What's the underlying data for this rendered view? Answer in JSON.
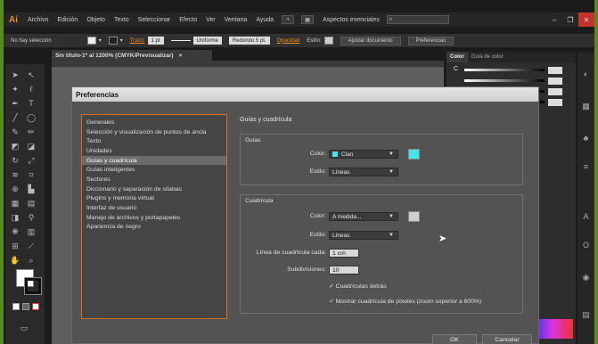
{
  "menubar": {
    "app_logo": "Ai",
    "items": [
      "Archivo",
      "Edición",
      "Objeto",
      "Texto",
      "Seleccionar",
      "Efecto",
      "Ver",
      "Ventana",
      "Ayuda"
    ],
    "workspace": "Aspectos esenciales",
    "window_controls": [
      "–",
      "❐",
      "✕"
    ]
  },
  "controlbar": {
    "selection": "No hay selección",
    "stroke_label": "Trazo:",
    "stroke_width": "1 pt",
    "stroke_profile": "Uniforme",
    "brush": "Redondo 5 pt.",
    "opacity_label": "Opacidad",
    "style_label": "Estilo:",
    "document_setup": "Ajustar documento",
    "preferences": "Preferencias"
  },
  "document_tab": {
    "title": "Sin título-1* al 1200% (CMYK/Previsualizar)",
    "close": "×"
  },
  "color_panel": {
    "tabs": [
      "Color",
      "Guía de color"
    ],
    "channel_label": "C"
  },
  "dialog": {
    "title": "Preferencias",
    "nav_items": [
      "Generales",
      "Selección y visualización de puntos de ancla",
      "Texto",
      "Unidades",
      "Guías y cuadrícula",
      "Guías inteligentes",
      "Sectores",
      "Diccionario y separación de sílabas",
      "Plugins y memoria virtual",
      "Interfaz de usuario",
      "Manejo de archivos y portapapeles",
      "Apariencia de negro"
    ],
    "active_nav_index": 4,
    "section_title": "Guías y cuadrícula",
    "guides": {
      "group_title": "Guías",
      "color_label": "Color:",
      "color_value": "Cian",
      "color_swatch": "#44e4ee",
      "style_label": "Estilo:",
      "style_value": "Líneas"
    },
    "grid": {
      "group_title": "Cuadrícula",
      "color_label": "Color:",
      "color_value": "A medida...",
      "color_swatch": "#cfcfcf",
      "style_label": "Estilo:",
      "style_value": "Líneas",
      "line_every_label": "Línea de cuadrícula cada:",
      "line_every_value": "1 cm",
      "subdivisions_label": "Subdivisiones:",
      "subdivisions_value": "10",
      "grids_behind": "✓ Cuadrículas detrás",
      "pixel_grid": "✓ Mostrar cuadrícula de píxeles (zoom superior a 600%)"
    },
    "ok": "OK",
    "cancel": "Cancelar"
  },
  "colors": {
    "accent_orange": "#d2701b",
    "frame_green": "#5a8a1a"
  }
}
